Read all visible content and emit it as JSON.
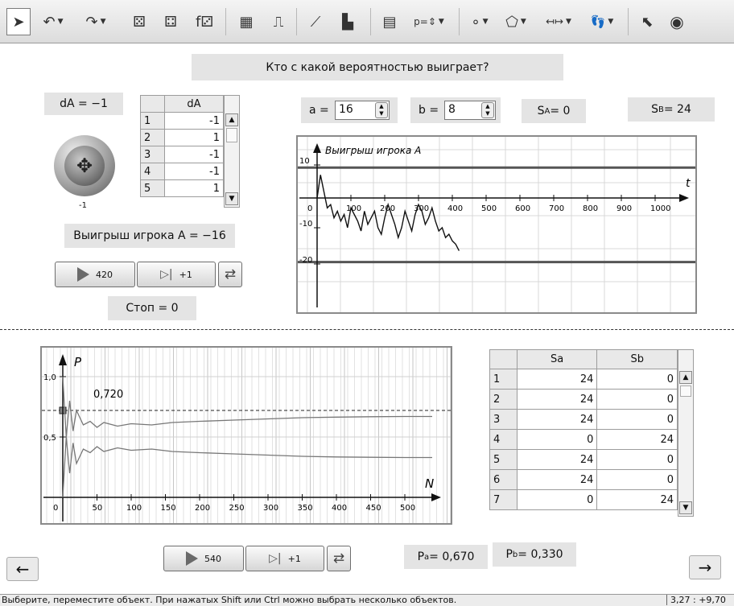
{
  "toolbar": {
    "tools": [
      {
        "icon": "pointer-icon",
        "glyph": "➤",
        "selected": true
      },
      {
        "icon": "undo-icon",
        "glyph": "↶",
        "dropdown": true
      },
      {
        "icon": "redo-icon",
        "glyph": "↷",
        "dropdown": true
      },
      {
        "icon": "dice-icon",
        "glyph": "⚄"
      },
      {
        "icon": "dice-arrow-icon",
        "glyph": "⚃"
      },
      {
        "icon": "function-dice-icon",
        "glyph": "f⚂"
      },
      {
        "icon": "table-icon",
        "glyph": "▦"
      },
      {
        "icon": "step-chart-icon",
        "glyph": "⎍"
      },
      {
        "icon": "line-chart-icon",
        "glyph": "⟋"
      },
      {
        "icon": "histogram-icon",
        "glyph": "▙"
      },
      {
        "icon": "calculator-icon",
        "glyph": "▤"
      },
      {
        "icon": "parameter-icon",
        "glyph": "p=⇕",
        "dropdown": true
      },
      {
        "icon": "point-icon",
        "glyph": "∘",
        "dropdown": true
      },
      {
        "icon": "polygon-icon",
        "glyph": "⬠",
        "dropdown": true
      },
      {
        "icon": "measure-icon",
        "glyph": "↤↦",
        "dropdown": true
      },
      {
        "icon": "trace-icon",
        "glyph": "👣",
        "dropdown": true
      },
      {
        "icon": "show-pointer-icon",
        "glyph": "⬉"
      },
      {
        "icon": "eye-icon",
        "glyph": "◉"
      }
    ]
  },
  "header": {
    "title": "Кто с какой вероятностью выиграет?"
  },
  "left": {
    "da_label": "dA = −1",
    "coin_caption": "-1",
    "win_label": "Выигрыш игрока A = −16",
    "stop_label": "Стоп = 0",
    "play_count": "420",
    "step_label": "+1"
  },
  "table_da": {
    "header": "dA",
    "rows": [
      {
        "n": "1",
        "v": "-1"
      },
      {
        "n": "2",
        "v": "1"
      },
      {
        "n": "3",
        "v": "-1"
      },
      {
        "n": "4",
        "v": "-1"
      },
      {
        "n": "5",
        "v": "1"
      }
    ]
  },
  "params": {
    "a_label": "a =",
    "a_value": "16",
    "b_label": "b =",
    "b_value": "8",
    "sa_prefix": "S",
    "sa_sub": "A",
    "sa_value": " = 0",
    "sb_prefix": "S",
    "sb_sub": "B",
    "sb_value": " = 24"
  },
  "walk_chart": {
    "title": "Выигрыш игрока A",
    "x_axis_label": "t",
    "x_ticks": [
      "0",
      "100",
      "200",
      "300",
      "400",
      "500",
      "600",
      "700",
      "800",
      "900",
      "1000"
    ],
    "y_ticks": [
      "10",
      "-10",
      "-20"
    ],
    "upper_line": 8,
    "lower_line": -16
  },
  "prob_chart": {
    "y_label": "P",
    "x_label": "N",
    "y_ticks": [
      "1,0",
      "0,5"
    ],
    "x_ticks": [
      "0",
      "50",
      "100",
      "150",
      "200",
      "250",
      "300",
      "350",
      "400",
      "450",
      "500"
    ],
    "marker_label": "0,720",
    "marker_value": 0.72
  },
  "chart_data": [
    {
      "type": "line",
      "title": "Выигрыш игрока A",
      "xlabel": "t",
      "ylabel": "",
      "xlim": [
        0,
        1000
      ],
      "ylim": [
        -20,
        10
      ],
      "reference_lines": [
        8,
        -16
      ],
      "series": [
        {
          "x": [
            0,
            10,
            20,
            30,
            40,
            50,
            60,
            70,
            80,
            90,
            100,
            110,
            120,
            130,
            140,
            150,
            160,
            170,
            180,
            190,
            200,
            210,
            220,
            230,
            240,
            250,
            260,
            270,
            280,
            290,
            300,
            310,
            320,
            330,
            340,
            350,
            360,
            370,
            380,
            390,
            400,
            410,
            420
          ],
          "y": [
            0,
            7,
            2,
            -3,
            -2,
            -6,
            -4,
            -7,
            -5,
            -9,
            -3,
            -5,
            -7,
            -10,
            -4,
            -8,
            -6,
            -4,
            -9,
            -11,
            -6,
            -2,
            -5,
            -8,
            -12,
            -9,
            -4,
            -7,
            -10,
            -5,
            -2,
            -4,
            -8,
            -6,
            -3,
            -7,
            -10,
            -9,
            -12,
            -11,
            -13,
            -14,
            -16
          ]
        }
      ]
    },
    {
      "type": "line",
      "title": "",
      "xlabel": "N",
      "ylabel": "P",
      "xlim": [
        0,
        540
      ],
      "ylim": [
        0,
        1.2
      ],
      "reference_lines": [
        0.72
      ],
      "series": [
        {
          "x": [
            0,
            5,
            10,
            15,
            20,
            30,
            40,
            50,
            60,
            80,
            100,
            130,
            160,
            200,
            250,
            300,
            350,
            400,
            450,
            500,
            540
          ],
          "y": [
            1.0,
            0.5,
            0.8,
            0.55,
            0.72,
            0.6,
            0.63,
            0.58,
            0.62,
            0.59,
            0.61,
            0.6,
            0.62,
            0.63,
            0.64,
            0.65,
            0.66,
            0.665,
            0.668,
            0.67,
            0.67
          ]
        },
        {
          "x": [
            0,
            5,
            10,
            15,
            20,
            30,
            40,
            50,
            60,
            80,
            100,
            130,
            160,
            200,
            250,
            300,
            350,
            400,
            450,
            500,
            540
          ],
          "y": [
            0,
            0.5,
            0.2,
            0.45,
            0.28,
            0.4,
            0.37,
            0.42,
            0.38,
            0.41,
            0.39,
            0.4,
            0.38,
            0.37,
            0.36,
            0.35,
            0.34,
            0.335,
            0.332,
            0.33,
            0.33
          ]
        }
      ]
    }
  ],
  "table_s": {
    "headers": [
      "Sa",
      "Sb"
    ],
    "rows": [
      {
        "n": "1",
        "a": "24",
        "b": "0"
      },
      {
        "n": "2",
        "a": "24",
        "b": "0"
      },
      {
        "n": "3",
        "a": "24",
        "b": "0"
      },
      {
        "n": "4",
        "a": "0",
        "b": "24"
      },
      {
        "n": "5",
        "a": "24",
        "b": "0"
      },
      {
        "n": "6",
        "a": "24",
        "b": "0"
      },
      {
        "n": "7",
        "a": "0",
        "b": "24"
      }
    ]
  },
  "bottom": {
    "play_count": "540",
    "step_label": "+1",
    "pa_prefix": "P",
    "pa_sub": "a",
    "pa_value": " = 0,670",
    "pb_prefix": "P",
    "pb_sub": "b",
    "pb_value": " = 0,330",
    "prev_arrow": "←",
    "next_arrow": "→"
  },
  "status": {
    "text": "Выберите, переместите объект. При нажатых Shift или Ctrl можно выбрать несколько объектов.",
    "coords": "3,27 : +9,70"
  },
  "colors": {
    "toolbar_bg": "#dcdcdc",
    "label_bg": "#e4e4e4",
    "plot_line": "#111111",
    "grid": "#d5d5d5"
  }
}
